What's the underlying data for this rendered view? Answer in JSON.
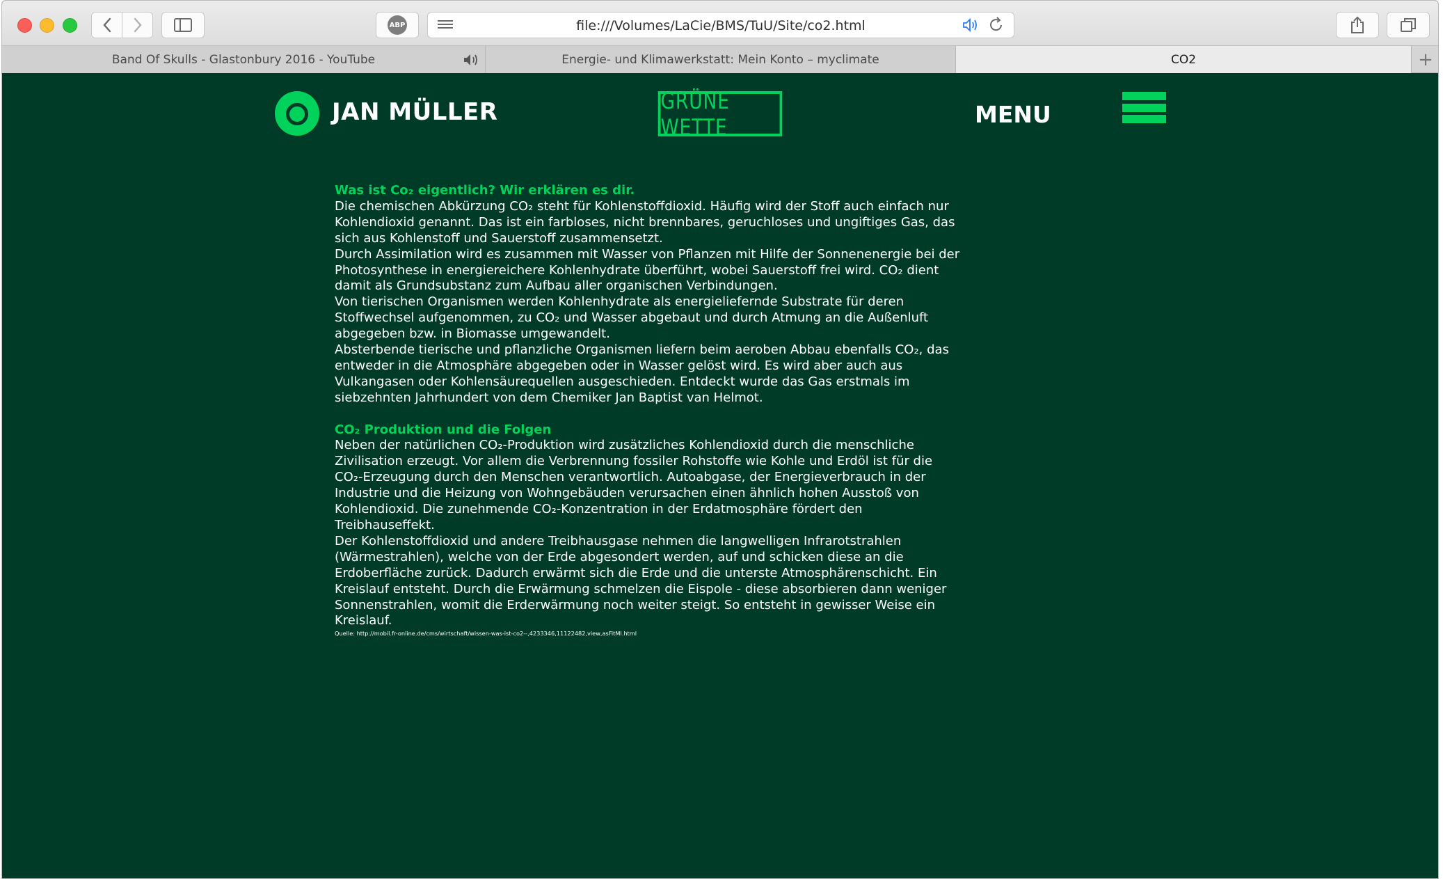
{
  "browser": {
    "url": "file:///Volumes/LaCie/BMS/TuU/Site/co2.html",
    "abp_label": "ABP",
    "tabs": [
      {
        "title": "Band Of Skulls - Glastonbury 2016 - YouTube"
      },
      {
        "title": "Energie- und Klimawerkstatt: Mein Konto – myclimate"
      },
      {
        "title": "CO2"
      }
    ]
  },
  "header": {
    "logo_name": "JAN MÜLLER",
    "brand": "GRÜNE WETTE",
    "menu_label": "MENU"
  },
  "article": {
    "section1_title": "Was ist Co₂ eigentlich? Wir erklären es dir.",
    "section1_paragraphs": [
      "Die chemischen Abkürzung CO₂ steht für Kohlenstoffdioxid. Häufig wird der Stoff auch einfach nur Kohlendioxid genannt. Das ist ein farbloses, nicht brennbares, geruchloses und ungiftiges Gas, das sich aus Kohlenstoff und Sauerstoff zusammensetzt.",
      "Durch Assimilation wird es zusammen mit Wasser von Pflanzen mit Hilfe der Sonnenenergie bei der Photosynthese in energiereichere Kohlenhydrate überführt, wobei Sauerstoff frei wird. CO₂ dient damit als Grundsubstanz zum Aufbau aller organischen Verbindungen.",
      "Von tierischen Organismen werden Kohlenhydrate als energieliefernde Substrate für deren Stoffwechsel aufgenommen, zu CO₂ und Wasser abgebaut und durch Atmung an die Außenluft abgegeben bzw. in Biomasse umgewandelt.",
      "Absterbende tierische und pflanzliche Organismen liefern beim aeroben Abbau ebenfalls CO₂, das entweder in die Atmosphäre abgegeben oder in Wasser gelöst wird. Es wird aber auch aus Vulkangasen oder Kohlensäurequellen ausgeschieden. Entdeckt wurde das Gas erstmals im siebzehnten Jahrhundert von dem Chemiker Jan Baptist van Helmot."
    ],
    "section2_title": "CO₂ Produktion und die Folgen",
    "section2_paragraphs": [
      "Neben der natürlichen CO₂-Produktion wird zusätzliches Kohlendioxid durch die menschliche Zivilisation erzeugt. Vor allem die Verbrennung fossiler Rohstoffe wie Kohle und Erdöl ist für die CO₂-Erzeugung durch den Menschen verantwortlich. Autoabgase, der Energieverbrauch in der Industrie und die Heizung von Wohngebäuden verursachen einen ähnlich hohen Ausstoß von Kohlendioxid. Die zunehmende CO₂-Konzentration in der Erdatmosphäre fördert den Treibhauseffekt.",
      "Der Kohlenstoffdioxid und andere Treibhausgase nehmen die langwelligen Infrarotstrahlen (Wärmestrahlen), welche von der Erde abgesondert werden, auf und schicken diese an die Erdoberfläche zurück. Dadurch erwärmt sich die Erde und die unterste Atmosphärenschicht. Ein Kreislauf entsteht. Durch die Erwärmung schmelzen die Eispole - diese absorbieren dann weniger Sonnenstrahlen, womit die Erderwärmung noch weiter steigt. So entsteht in gewisser Weise ein Kreislauf."
    ],
    "source": "Quelle: http://mobil.fr-online.de/cms/wirtschaft/wissen-was-ist-co2--,4233346,11122482,view,asFitMl.html"
  },
  "colors": {
    "background": "#003b27",
    "accent": "#00d25b",
    "text": "#ffffff"
  }
}
